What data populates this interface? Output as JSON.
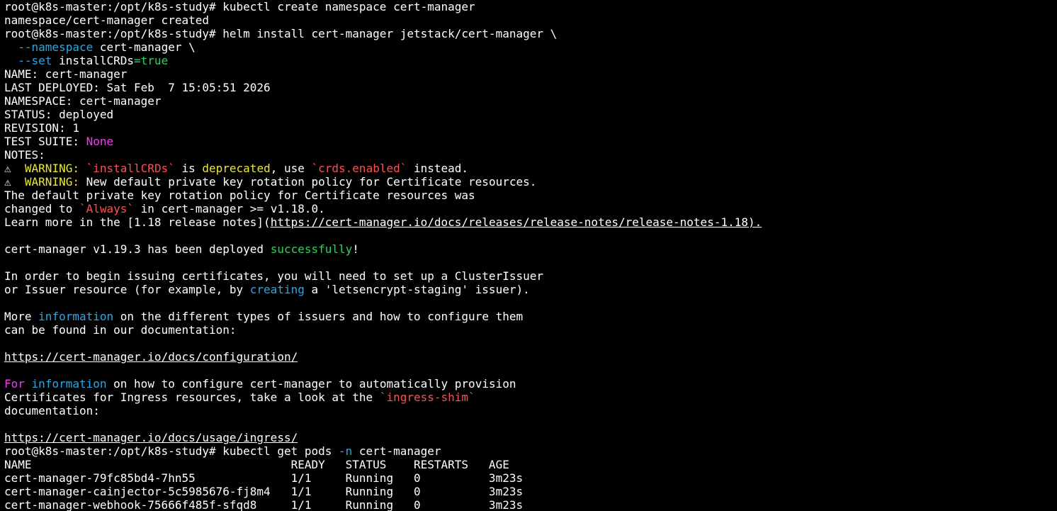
{
  "colors": {
    "background": "#000000",
    "default": "#ffffff",
    "blue": "#29a8e6",
    "green": "#2fd15f",
    "magenta": "#f03cf0",
    "yellow": "#e8e83a",
    "red": "#ff5050"
  },
  "lines": [
    {
      "segs": [
        {
          "t": "root@k8s-master:/opt/k8s-study# kubectl create namespace cert-manager"
        }
      ]
    },
    {
      "segs": [
        {
          "t": "namespace/cert-manager created"
        }
      ]
    },
    {
      "segs": [
        {
          "t": "root@k8s-master:/opt/k8s-study# helm install cert-manager jetstack/cert-manager \\"
        }
      ]
    },
    {
      "segs": [
        {
          "t": "  "
        },
        {
          "t": "--namespace",
          "c": "blue"
        },
        {
          "t": " cert-manager \\"
        }
      ]
    },
    {
      "segs": [
        {
          "t": "  "
        },
        {
          "t": "--set",
          "c": "blue"
        },
        {
          "t": " installCRDs"
        },
        {
          "t": "=true",
          "c": "green"
        }
      ]
    },
    {
      "segs": [
        {
          "t": "NAME: cert-manager"
        }
      ]
    },
    {
      "segs": [
        {
          "t": "LAST DEPLOYED: Sat Feb  7 15:05:51 2026"
        }
      ]
    },
    {
      "segs": [
        {
          "t": "NAMESPACE: cert-manager"
        }
      ]
    },
    {
      "segs": [
        {
          "t": "STATUS: deployed"
        }
      ]
    },
    {
      "segs": [
        {
          "t": "REVISION: 1"
        }
      ]
    },
    {
      "segs": [
        {
          "t": "TEST SUITE: "
        },
        {
          "t": "None",
          "c": "magenta"
        }
      ]
    },
    {
      "segs": [
        {
          "t": "NOTES:"
        }
      ]
    },
    {
      "segs": [
        {
          "t": "⚠  "
        },
        {
          "t": "WARNING:",
          "c": "yellow"
        },
        {
          "t": " "
        },
        {
          "t": "`installCRDs`",
          "c": "red"
        },
        {
          "t": " is "
        },
        {
          "t": "deprecated",
          "c": "yellow"
        },
        {
          "t": ", use "
        },
        {
          "t": "`crds.enabled`",
          "c": "red"
        },
        {
          "t": " instead."
        }
      ]
    },
    {
      "segs": [
        {
          "t": "⚠  "
        },
        {
          "t": "WARNING:",
          "c": "yellow"
        },
        {
          "t": " New default private key rotation policy for Certificate resources."
        }
      ]
    },
    {
      "segs": [
        {
          "t": "The default private key rotation policy for Certificate resources was"
        }
      ]
    },
    {
      "segs": [
        {
          "t": "changed to "
        },
        {
          "t": "`Always`",
          "c": "red"
        },
        {
          "t": " in cert-manager >= v1.18.0."
        }
      ]
    },
    {
      "segs": [
        {
          "t": "Learn more in the [1.18 release notes]("
        },
        {
          "t": "https://cert-manager.io/docs/releases/release-notes/release-notes-1.18).",
          "u": true
        }
      ]
    },
    {
      "segs": []
    },
    {
      "segs": [
        {
          "t": "cert-manager v1.19.3 has been deployed "
        },
        {
          "t": "successfully",
          "c": "green"
        },
        {
          "t": "!"
        }
      ]
    },
    {
      "segs": []
    },
    {
      "segs": [
        {
          "t": "In order to begin issuing certificates, you will need to set up a ClusterIssuer"
        }
      ]
    },
    {
      "segs": [
        {
          "t": "or Issuer resource (for example, by "
        },
        {
          "t": "creating",
          "c": "blue"
        },
        {
          "t": " a 'letsencrypt-staging' issuer)."
        }
      ]
    },
    {
      "segs": []
    },
    {
      "segs": [
        {
          "t": "More "
        },
        {
          "t": "information",
          "c": "blue"
        },
        {
          "t": " on the different types of issuers and how to configure them"
        }
      ]
    },
    {
      "segs": [
        {
          "t": "can be found in our documentation:"
        }
      ]
    },
    {
      "segs": []
    },
    {
      "segs": [
        {
          "t": "https://cert-manager.io/docs/configuration/",
          "u": true
        }
      ]
    },
    {
      "segs": []
    },
    {
      "segs": [
        {
          "t": "For",
          "c": "magenta"
        },
        {
          "t": " "
        },
        {
          "t": "information",
          "c": "blue"
        },
        {
          "t": " on how to configure cert-manager to automatically provision"
        }
      ]
    },
    {
      "segs": [
        {
          "t": "Certificates for Ingress resources, take a look at the "
        },
        {
          "t": "`ingress-shim`",
          "c": "red"
        }
      ]
    },
    {
      "segs": [
        {
          "t": "documentation:"
        }
      ]
    },
    {
      "segs": []
    },
    {
      "segs": [
        {
          "t": "https://cert-manager.io/docs/usage/ingress/",
          "u": true
        }
      ]
    },
    {
      "segs": [
        {
          "t": "root@k8s-master:/opt/k8s-study# kubectl get pods "
        },
        {
          "t": "-n",
          "c": "blue"
        },
        {
          "t": " cert-manager"
        }
      ]
    },
    {
      "segs": [
        {
          "t": "NAME                                 READY   STATUS    RESTARTS   AGE"
        }
      ]
    },
    {
      "segs": [
        {
          "t": "cert-manager-79fc85bd4-7hn55         1/1     Running   0          3m23s"
        }
      ]
    },
    {
      "segs": [
        {
          "t": "cert-manager-cainjector-5c5985676-fj8m4   1/1     Running   0          3m23s"
        }
      ]
    },
    {
      "segs": [
        {
          "t": "cert-manager-webhook-75666f485f-sfqd8     1/1     Running   0          3m23s"
        }
      ]
    }
  ]
}
